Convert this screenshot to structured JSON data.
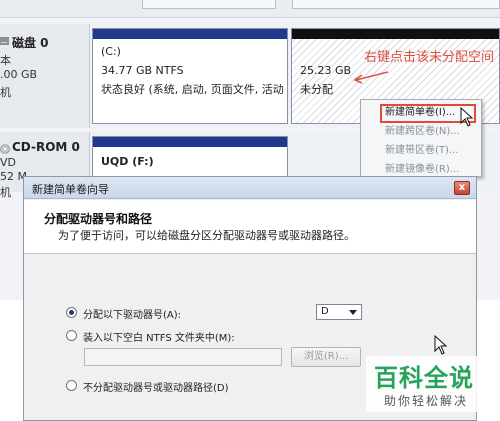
{
  "disks": [
    {
      "name": "磁盘 0",
      "lines": [
        "本",
        ".00 GB",
        "机"
      ],
      "partitions": [
        {
          "label": "(C:)",
          "size": "34.77 GB NTFS",
          "status": "状态良好 (系统, 启动, 页面文件, 活动"
        },
        {
          "label": "",
          "size": "25.23 GB",
          "status": "未分配"
        }
      ]
    },
    {
      "name": "CD-ROM 0",
      "lines": [
        "VD",
        "52 M",
        "机"
      ],
      "partitions": [
        {
          "label": "UQD  (F:)",
          "size": "",
          "status": ""
        }
      ]
    }
  ],
  "annotation": {
    "text": "右键点击该未分配空间"
  },
  "context_menu": {
    "items": [
      {
        "label": "新建简单卷(I)...",
        "enabled": true
      },
      {
        "label": "新建跨区卷(N)...",
        "enabled": false
      },
      {
        "label": "新建带区卷(T)...",
        "enabled": false
      },
      {
        "label": "新建镜像卷(R)...",
        "enabled": false
      }
    ]
  },
  "wizard": {
    "title": "新建简单卷向导",
    "close_label": "x",
    "header_title": "分配驱动器号和路径",
    "header_desc": "为了便于访问，可以给磁盘分区分配驱动器号或驱动器路径。",
    "options": [
      {
        "label": "分配以下驱动器号(A):",
        "checked": true
      },
      {
        "label": "装入以下空白 NTFS 文件夹中(M):",
        "checked": false
      },
      {
        "label": "不分配驱动器号或驱动器路径(D)",
        "checked": false
      }
    ],
    "drive_letter": "D",
    "folder_path": "",
    "browse_label": "浏览(R)..."
  },
  "watermark": {
    "title": "百科全说",
    "subtitle": "助你轻松解决"
  },
  "colors": {
    "annotation": "#e05040",
    "highlight": "#e04a3a",
    "primary_bar": "#1f3a8c",
    "unalloc_bar": "#111111",
    "watermark": "#26a35a"
  }
}
